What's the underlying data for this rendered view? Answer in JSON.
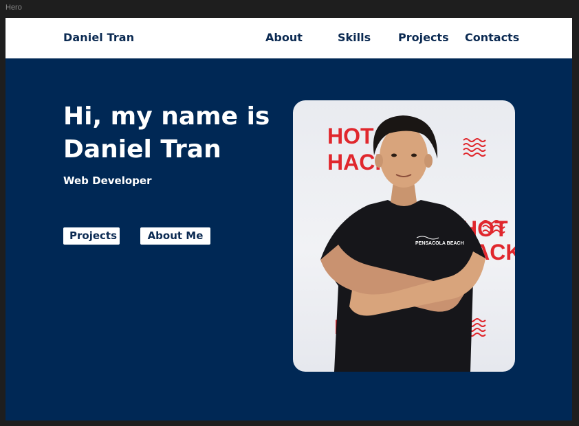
{
  "frame": {
    "label": "Hero"
  },
  "nav": {
    "brand": "Daniel Tran",
    "links": [
      "About",
      "Skills",
      "Projects",
      "Contacts"
    ]
  },
  "hero": {
    "heading_line1": "Hi, my name is",
    "heading_line2": "Daniel Tran",
    "subtitle": "Web Developer",
    "buttons": {
      "projects": "Projects",
      "about": "About Me"
    }
  },
  "photo": {
    "backdrop_text": [
      "HOT",
      "HACK"
    ],
    "shirt_text": "PENSACOLA BEACH",
    "accent_color": "#e0272d"
  },
  "colors": {
    "hero_background": "#002855",
    "nav_background": "#ffffff",
    "text_dark": "#0b2a52",
    "text_light": "#ffffff"
  }
}
